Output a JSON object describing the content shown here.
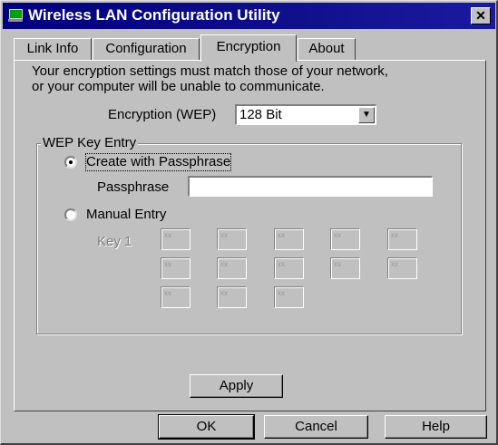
{
  "window": {
    "title": "Wireless LAN Configuration Utility",
    "close_glyph": "✕",
    "app_icon": "network-icon"
  },
  "tabs": [
    {
      "label": "Link Info",
      "active": false
    },
    {
      "label": "Configuration",
      "active": false
    },
    {
      "label": "Encryption",
      "active": true
    },
    {
      "label": "About",
      "active": false
    }
  ],
  "encryption": {
    "intro_line1": "Your encryption settings must match those of your network,",
    "intro_line2": "or your computer will be unable to communicate.",
    "wep_label": "Encryption (WEP)",
    "wep_value": "128 Bit",
    "dropdown_glyph": "▼"
  },
  "wep_key_entry": {
    "legend": "WEP Key Entry",
    "option_passphrase": "Create with Passphrase",
    "passphrase_label": "Passphrase",
    "passphrase_value": "",
    "option_manual": "Manual Entry",
    "selected_option": "Create with Passphrase",
    "key_label": "Key 1",
    "key_cells": [
      "xx",
      "xx",
      "xx",
      "xx",
      "xx",
      "xx",
      "xx",
      "xx",
      "xx",
      "xx",
      "xx",
      "xx",
      "xx"
    ]
  },
  "buttons": {
    "apply": "Apply",
    "ok": "OK",
    "cancel": "Cancel",
    "help": "Help"
  },
  "colors": {
    "title_bar": "#00007f",
    "face": "#c0c0c0",
    "title_text": "#ffffff"
  }
}
